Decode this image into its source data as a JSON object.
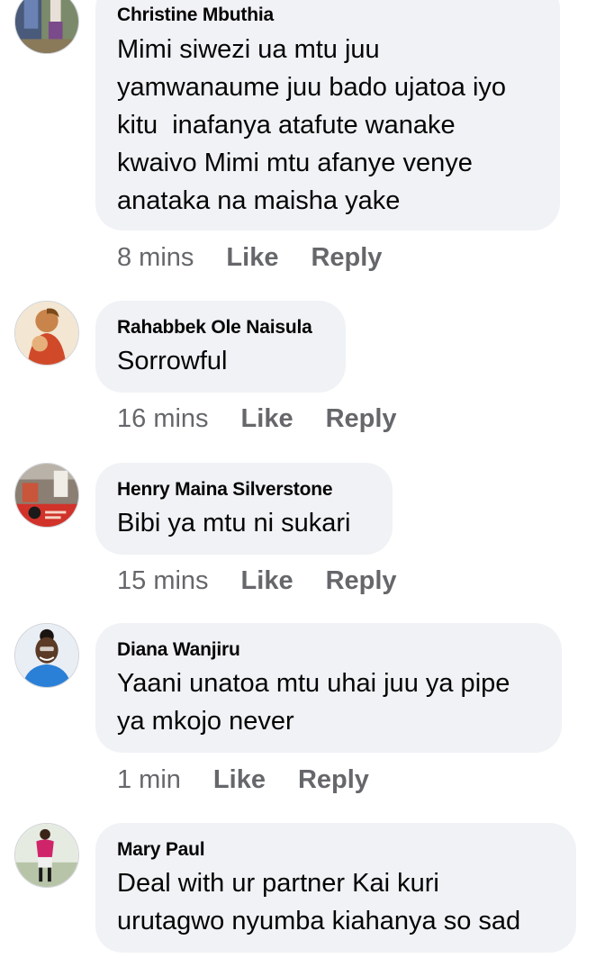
{
  "comments": [
    {
      "author": "Christine Mbuthia",
      "text": "Mimi siwezi ua mtu juu\nyamwanaume juu bado ujatoa iyo\nkitu  inafanya atafute wanake\nkwaivo Mimi mtu afanye venye\nanataka na maisha yake",
      "time": "8 mins",
      "like": "Like",
      "reply": "Reply"
    },
    {
      "author": "Rahabbek Ole Naisula",
      "text": "Sorrowful",
      "time": "16 mins",
      "like": "Like",
      "reply": "Reply"
    },
    {
      "author": "Henry Maina Silverstone",
      "text": "Bibi ya mtu ni sukari",
      "time": "15 mins",
      "like": "Like",
      "reply": "Reply"
    },
    {
      "author": "Diana Wanjiru",
      "text": "Yaani unatoa mtu uhai juu ya pipe\nya mkojo never",
      "time": "1 min",
      "like": "Like",
      "reply": "Reply"
    },
    {
      "author": "Mary Paul",
      "text": "Deal with ur partner Kai kuri\nurutagwo nyumba kiahanya so sad",
      "time": "",
      "like": "",
      "reply": ""
    }
  ],
  "colors": {
    "bubble": "#f0f2f5",
    "meta_text": "#65676b",
    "name_text": "#050505"
  }
}
